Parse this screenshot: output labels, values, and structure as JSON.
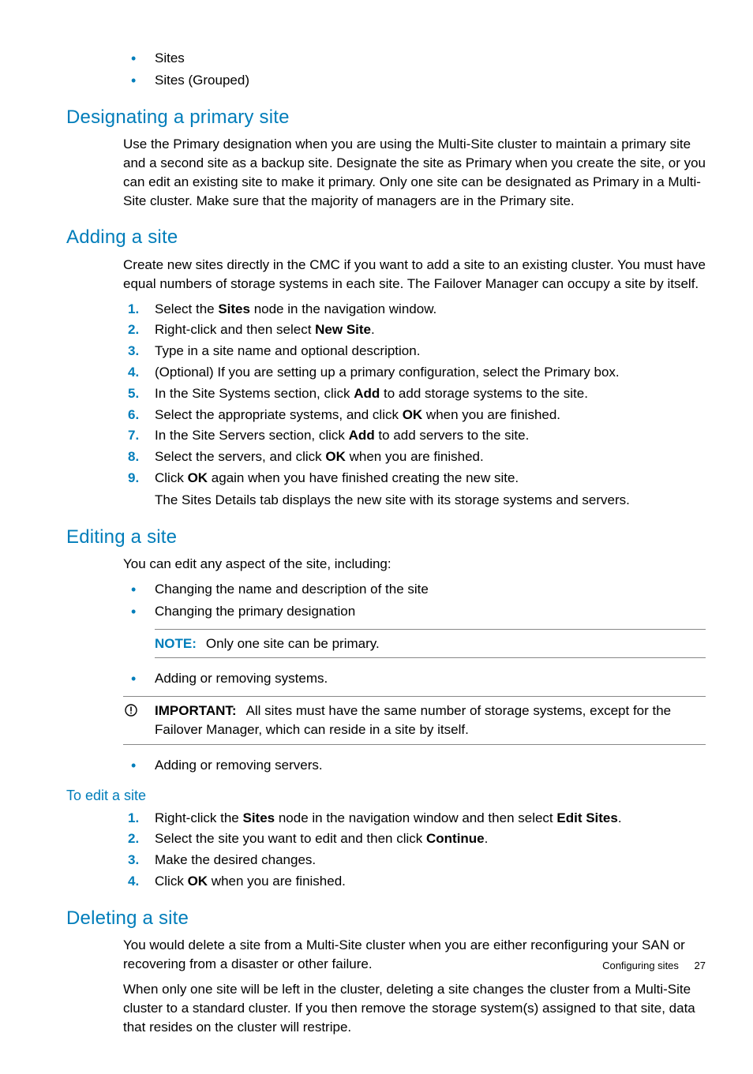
{
  "top_bullets": [
    "Sites",
    "Sites (Grouped)"
  ],
  "sec1": {
    "title": "Designating a primary site",
    "para": "Use the Primary designation when you are using the Multi-Site cluster to maintain a primary site and a second site as a backup site. Designate the site as Primary when you create the site, or you can edit an existing site to make it primary. Only one site can be designated as Primary in a Multi-Site cluster. Make sure that the majority of managers are in the Primary site."
  },
  "sec2": {
    "title": "Adding a site",
    "intro": "Create new sites directly in the CMC if you want to add a site to an existing cluster. You must have equal numbers of storage systems in each site. The Failover Manager can occupy a site by itself.",
    "steps": {
      "s1a": "Select the ",
      "s1b": "Sites",
      "s1c": " node in the navigation window.",
      "s2a": "Right-click and then select ",
      "s2b": "New Site",
      "s2c": ".",
      "s3": "Type in a site name and optional description.",
      "s4": "(Optional) If you are setting up a primary configuration, select the Primary box.",
      "s5a": "In the Site Systems section, click ",
      "s5b": "Add",
      "s5c": " to add storage systems to the site.",
      "s6a": "Select the appropriate systems, and click ",
      "s6b": "OK",
      "s6c": " when you are finished.",
      "s7a": "In the Site Servers section, click ",
      "s7b": "Add",
      "s7c": " to add servers to the site.",
      "s8a": "Select the servers, and click ",
      "s8b": "OK",
      "s8c": " when you are finished.",
      "s9a": "Click ",
      "s9b": "OK",
      "s9c": " again when you have finished creating the new site.",
      "after": "The Sites Details tab displays the new site with its storage systems and servers."
    }
  },
  "sec3": {
    "title": "Editing a site",
    "intro": "You can edit any aspect of the site, including:",
    "b1": "Changing the name and description of the site",
    "b2": "Changing the primary designation",
    "note_label": "NOTE:",
    "note_text": "Only one site can be primary.",
    "b3": "Adding or removing systems.",
    "imp_label": "IMPORTANT:",
    "imp_text": "All sites must have the same number of storage systems, except for the Failover Manager, which can reside in a site by itself.",
    "b4": "Adding or removing servers."
  },
  "sec3b": {
    "title": "To edit a site",
    "s1a": "Right-click the ",
    "s1b": "Sites",
    "s1c": " node in the navigation window and then select ",
    "s1d": "Edit Sites",
    "s1e": ".",
    "s2a": "Select the site you want to edit and then click ",
    "s2b": "Continue",
    "s2c": ".",
    "s3": "Make the desired changes.",
    "s4a": "Click ",
    "s4b": "OK",
    "s4c": " when you are finished."
  },
  "sec4": {
    "title": "Deleting a site",
    "p1": "You would delete a site from a Multi-Site cluster when you are either reconfiguring your SAN or recovering from a disaster or other failure.",
    "p2": "When only one site will be left in the cluster, deleting a site changes the cluster from a Multi-Site cluster to a standard cluster. If you then remove the storage system(s) assigned to that site, data that resides on the cluster will restripe."
  },
  "footer": {
    "section": "Configuring sites",
    "page": "27"
  }
}
